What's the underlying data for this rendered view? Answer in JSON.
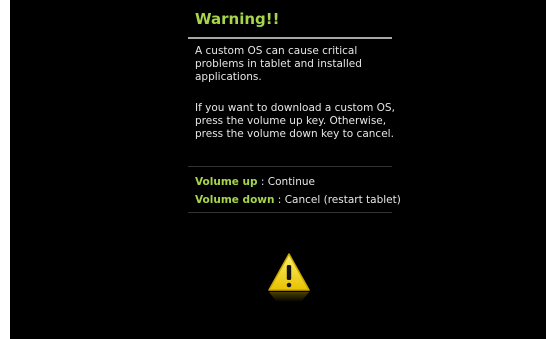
{
  "dialog": {
    "title": "Warning!!",
    "message_1": "A custom OS can cause critical problems in tablet and installed applications.",
    "message_2": "If you want to download a custom OS, press the volume up key. Otherwise, press the volume down key to cancel."
  },
  "options": [
    {
      "key": "Volume up",
      "separator": " : ",
      "action": "Continue"
    },
    {
      "key": "Volume down",
      "separator": " : ",
      "action": "Cancel (restart tablet)"
    }
  ],
  "colors": {
    "accent": "#a7d54a",
    "background": "#000000",
    "text": "#e6e6e6",
    "warning_icon": "#f5d400"
  },
  "icons": [
    "warning-triangle-icon"
  ]
}
